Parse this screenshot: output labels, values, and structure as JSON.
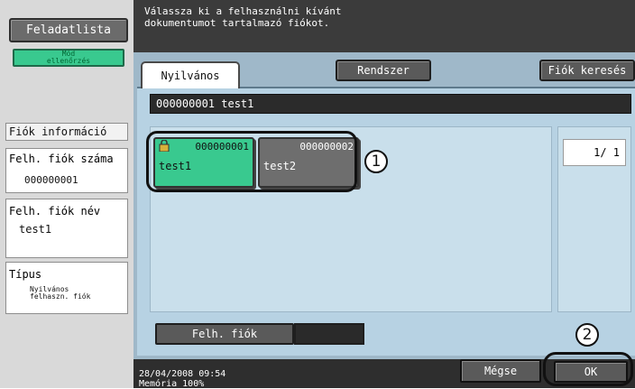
{
  "sidebar": {
    "job_list_label": "Feladatlista",
    "mode_check_label": "Mód\nellenőrzés",
    "account_info_title": "Fiók információ",
    "account_number_label": "Felh. fiók száma",
    "account_number_value": "000000001",
    "account_name_label": "Felh. fiók név",
    "account_name_value": "test1",
    "type_label": "Típus",
    "type_value": "Nyilvános\nfelhaszn. fiók"
  },
  "header": {
    "instruction": "Válassza ki a felhasználni kívánt\ndokumentumot tartalmazó fiókot."
  },
  "tabs": {
    "public": "Nyilvános",
    "system": "Rendszer",
    "search": "Fiók keresés"
  },
  "selected": {
    "text": "000000001  test1"
  },
  "boxes": [
    {
      "id": "000000001",
      "name": "test1",
      "selected": true,
      "locked": true
    },
    {
      "id": "000000002",
      "name": "test2",
      "selected": false,
      "locked": false
    }
  ],
  "pager": {
    "text": "1/  1"
  },
  "actions": {
    "account_button": "Felh. fiók",
    "cancel": "Mégse",
    "ok": "OK"
  },
  "status": {
    "datetime": "28/04/2008   09:54\nMemória      100%"
  },
  "callouts": {
    "one": "1",
    "two": "2"
  },
  "colors": {
    "selected_box": "#39c98f",
    "unselected_box": "#6e6e6e"
  }
}
